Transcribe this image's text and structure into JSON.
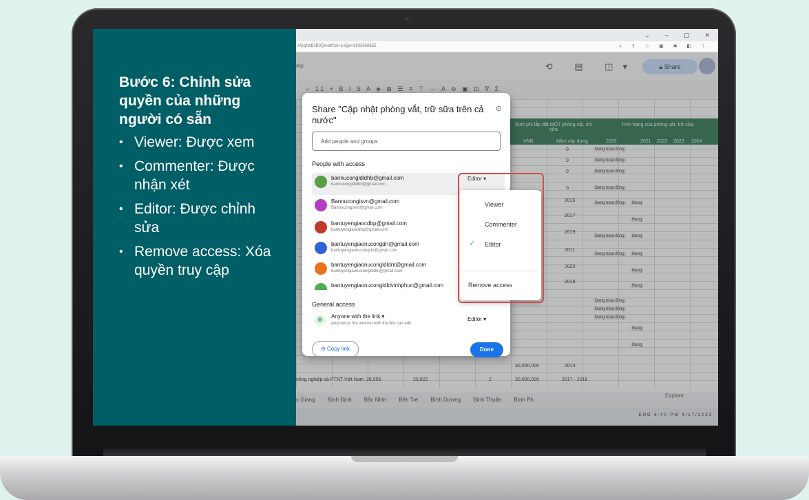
{
  "panel": {
    "heading": "Bước 6: Chỉnh sửa quyền của những người có sẵn",
    "bullets": [
      "Viewer: Được xem",
      "Commenter: Được nhận xét",
      "Editor: Được chỉnh sửa",
      "Remove access: Xóa quyền truy cập"
    ]
  },
  "browser": {
    "url": "AGqNhBvB0Q/edit?pli=1#gid=1935668655",
    "share_label": "Share"
  },
  "sheet": {
    "header_text": "Kinh phí lắp đặt MỘT phòng vắt, trữ sữa",
    "header_right": "Tình trạng của phòng vắt, trữ sữa",
    "col_vnd": "VNĐ",
    "col_year": "Năm xây dựng",
    "years": [
      "2020",
      "2021",
      "2022",
      "2023",
      "2024"
    ],
    "zero": "0",
    "years_built": [
      "2016",
      "2017",
      "2019",
      "2011",
      "2020",
      "2018"
    ],
    "status_active": "Đang hoạt động",
    "status_short": "Đang",
    "amount": "30,000,000",
    "amount_year": "2014",
    "amount_year2": "2017 - 2018",
    "bottom_row": "nông nghiệp và PTNT Việt Nam",
    "bottom_num1": "28,505",
    "bottom_num2": "20,822",
    "bottom_num3": "2",
    "tabs": [
      "c Giang",
      "Bình Định",
      "Bắc Ninh",
      "Bến Tre",
      "Bình Dương",
      "Bình Thuận",
      "Bình Ph"
    ],
    "explore": "Explore",
    "clock_time": "6:40 PM",
    "clock_date": "4/17/2023",
    "tray_lang": "ENG"
  },
  "dialog": {
    "title": "Share \"Cập nhật phòng vắt, trữ sữa trên cả nước\"",
    "add_placeholder": "Add people and groups",
    "people_label": "People with access",
    "people": [
      {
        "email": "bannucongldldhb@gmail.com",
        "sub": "bannucongldldhb@gmail.com",
        "color": "#5a9e45"
      },
      {
        "email": "Bannucongisvn@gmail.com",
        "sub": "Bannucongisvn@gmail.com",
        "color": "#b13ec2"
      },
      {
        "email": "bantuyengiaocdbp@gmail.com",
        "sub": "bantuyengiaocdbp@gmail.com",
        "color": "#c0392b"
      },
      {
        "email": "bantuyengiaonucongdn@gmail.com",
        "sub": "bantuyengiaonucongdn@gmail.com",
        "color": "#2f62d6"
      },
      {
        "email": "bantuyengiaonucongldldnt@gmail.com",
        "sub": "bantuyengiaonucongldldnt@gmail.com",
        "color": "#e8711c"
      },
      {
        "email": "bantuyengiaonucongldldvinhphuc@gmail.com",
        "sub": "",
        "color": "#4caf50"
      }
    ],
    "selected_role": "Editor",
    "general_label": "General access",
    "anyone_label": "Anyone with the link",
    "anyone_sub": "Anyone on the internet with the link can edit",
    "general_role": "Editor",
    "copy_link": "Copy link",
    "done": "Done"
  },
  "dropdown": {
    "items": [
      "Viewer",
      "Commenter",
      "Editor"
    ],
    "checked": "Editor",
    "remove": "Remove access"
  },
  "colors": {
    "panel": "#005e66",
    "accent": "#1a73e8",
    "highlight": "#d94a4a",
    "background": "#dff3ee"
  }
}
